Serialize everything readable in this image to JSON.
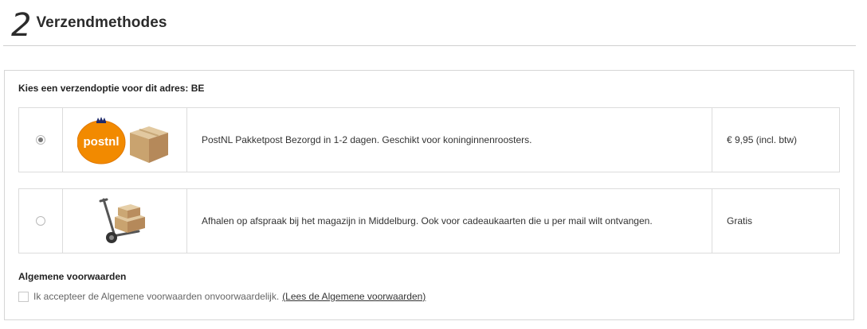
{
  "header": {
    "step_number": "2",
    "title": "Verzendmethodes"
  },
  "shipping": {
    "prompt": "Kies een verzendoptie voor dit adres: BE",
    "options": [
      {
        "selected": true,
        "logo_text": "postnl",
        "icon": "postnl-package-icon",
        "description": "PostNL Pakketpost Bezorgd in 1-2 dagen. Geschikt voor koninginnenroosters.",
        "price": "€ 9,95 (incl. btw)"
      },
      {
        "selected": false,
        "icon": "hand-truck-boxes-icon",
        "description": "Afhalen op afspraak bij het magazijn in Middelburg. Ook voor cadeaukaarten die u per mail wilt ontvangen.",
        "price": "Gratis"
      }
    ]
  },
  "terms": {
    "heading": "Algemene voorwaarden",
    "checked": false,
    "checkbox_label": "Ik accepteer de Algemene voorwaarden onvoorwaardelijk.",
    "link_text": "(Lees de Algemene voorwaarden)"
  },
  "colors": {
    "postnl_orange": "#F28A00",
    "postnl_logo_text": "#ffffff",
    "border": "#d6d6d6"
  }
}
